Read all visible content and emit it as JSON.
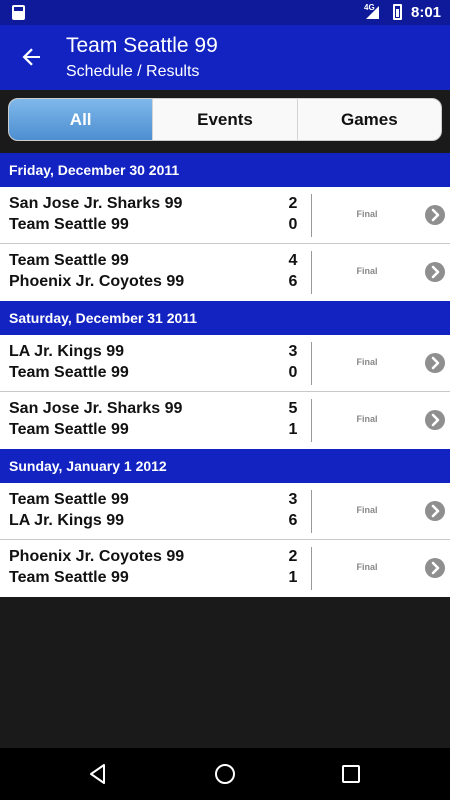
{
  "status_bar": {
    "network": "4G",
    "time": "8:01"
  },
  "app_bar": {
    "title": "Team Seattle 99",
    "subtitle": "Schedule / Results"
  },
  "filter_tabs": [
    {
      "label": "All",
      "active": true
    },
    {
      "label": "Events",
      "active": false
    },
    {
      "label": "Games",
      "active": false
    }
  ],
  "schedule": [
    {
      "date": "Friday, December 30 2011",
      "games": [
        {
          "team1": "San Jose Jr. Sharks 99",
          "score1": "2",
          "team2": "Team Seattle 99",
          "score2": "0",
          "status": "Final"
        },
        {
          "team1": "Team Seattle 99",
          "score1": "4",
          "team2": "Phoenix Jr. Coyotes 99",
          "score2": "6",
          "status": "Final"
        }
      ]
    },
    {
      "date": "Saturday, December 31 2011",
      "games": [
        {
          "team1": "LA Jr. Kings 99",
          "score1": "3",
          "team2": "Team Seattle 99",
          "score2": "0",
          "status": "Final"
        },
        {
          "team1": "San Jose Jr. Sharks 99",
          "score1": "5",
          "team2": "Team Seattle 99",
          "score2": "1",
          "status": "Final"
        }
      ]
    },
    {
      "date": "Sunday, January 1 2012",
      "games": [
        {
          "team1": "Team Seattle 99",
          "score1": "3",
          "team2": "LA Jr. Kings 99",
          "score2": "6",
          "status": "Final"
        },
        {
          "team1": "Phoenix Jr. Coyotes 99",
          "score1": "2",
          "team2": "Team Seattle 99",
          "score2": "1",
          "status": "Final"
        }
      ]
    }
  ],
  "icons": {
    "back": "arrow-back-icon",
    "row_detail": "chevron-right-circle-icon",
    "nav_back": "triangle-back-icon",
    "nav_home": "circle-home-icon",
    "nav_recents": "square-recents-icon"
  },
  "colors": {
    "primary": "#1223c2",
    "status_bar": "#0e1a9a",
    "active_tab": "#4d8fd1"
  }
}
